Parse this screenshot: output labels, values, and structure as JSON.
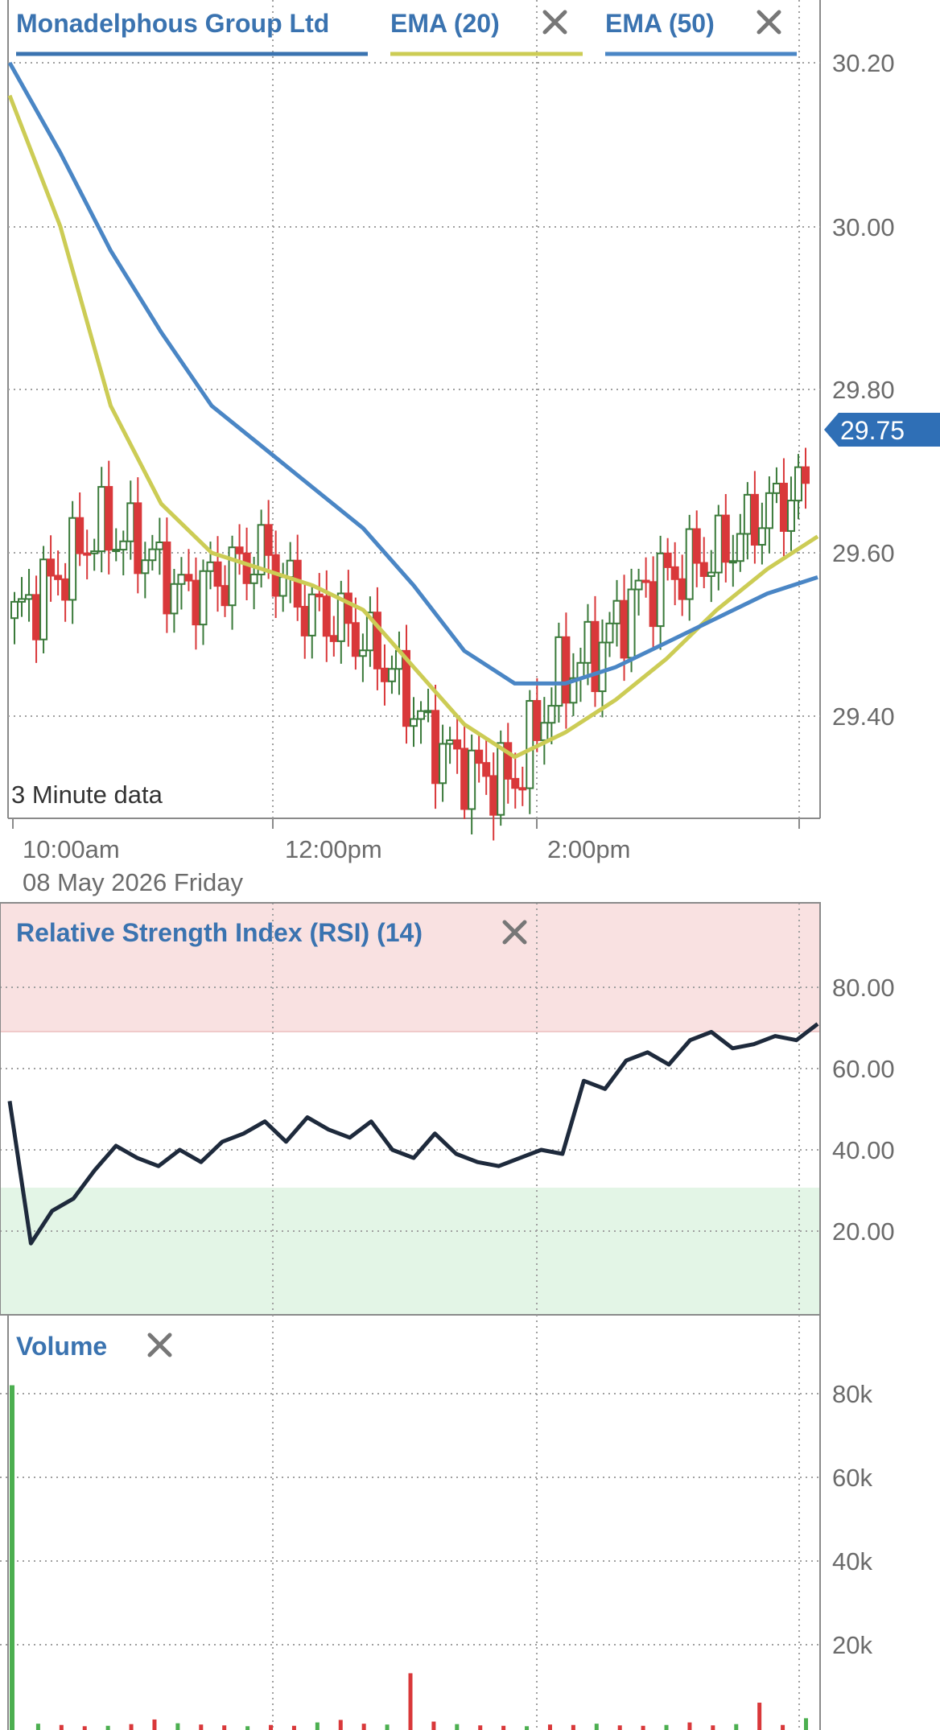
{
  "header": {
    "instrument": "Monadelphous Group Ltd",
    "ema20_label": "EMA (20)",
    "ema50_label": "EMA (50)",
    "close_icon": "close-icon"
  },
  "price_panel": {
    "note": "3 Minute data",
    "current_price": "29.75",
    "y_ticks": [
      "30.20",
      "30.00",
      "29.80",
      "29.60",
      "29.40"
    ],
    "x_ticks": [
      "10:00am",
      "12:00pm",
      "2:00pm"
    ],
    "date_label": "08 May 2026 Friday"
  },
  "rsi_panel": {
    "title": "Relative Strength Index (RSI) (14)",
    "y_ticks": [
      "80.00",
      "60.00",
      "40.00",
      "20.00"
    ]
  },
  "volume_panel": {
    "title": "Volume",
    "y_ticks": [
      "80k",
      "60k",
      "40k",
      "20k"
    ]
  },
  "colors": {
    "instrument": "#3a73b0",
    "ema20": "#cccc55",
    "ema50": "#4a86c5",
    "up": "#3a7a3a",
    "down": "#d9383a",
    "rsi": "#1e2a3c",
    "overbought": "#f9e1e1",
    "oversold": "#e3f5e6",
    "badge": "#2f6fb6"
  },
  "chart_data": [
    {
      "type": "line",
      "title": "Monadelphous Group Ltd",
      "subtitle": "3 Minute data",
      "x_ticks": [
        "10:00am",
        "12:00pm",
        "2:00pm"
      ],
      "ylim": [
        29.28,
        30.22
      ],
      "current_price": 29.75,
      "series": [
        {
          "name": "EMA (20)",
          "values": [
            30.16,
            30.0,
            29.78,
            29.66,
            29.6,
            29.58,
            29.56,
            29.53,
            29.46,
            29.39,
            29.35,
            29.38,
            29.42,
            29.47,
            29.53,
            29.58,
            29.62
          ]
        },
        {
          "name": "EMA (50)",
          "values": [
            30.2,
            30.09,
            29.97,
            29.87,
            29.78,
            29.73,
            29.68,
            29.63,
            29.56,
            29.48,
            29.44,
            29.44,
            29.46,
            29.49,
            29.52,
            29.55,
            29.57
          ]
        },
        {
          "name": "Price close",
          "values": [
            29.52,
            29.57,
            29.63,
            29.61,
            29.55,
            29.57,
            29.6,
            29.53,
            29.51,
            29.46,
            29.37,
            29.33,
            29.32,
            29.44,
            29.48,
            29.55,
            29.58,
            29.6,
            29.65,
            29.68
          ]
        }
      ],
      "grid": true
    },
    {
      "type": "line",
      "title": "Relative Strength Index (RSI) (14)",
      "ylim": [
        0,
        100
      ],
      "bands": {
        "overbought": [
          70,
          100
        ],
        "oversold": [
          0,
          30
        ]
      },
      "series": [
        {
          "name": "Relative Strength Index (RSI) (14)",
          "values": [
            52,
            17,
            25,
            28,
            35,
            41,
            38,
            36,
            40,
            37,
            42,
            44,
            47,
            42,
            48,
            45,
            43,
            47,
            40,
            38,
            44,
            39,
            37,
            36,
            38,
            40,
            39,
            57,
            55,
            62,
            64,
            61,
            67,
            69,
            65,
            66,
            68,
            67,
            71
          ]
        }
      ],
      "grid": true
    },
    {
      "type": "bar",
      "title": "Volume",
      "y_ticks": [
        "80k",
        "60k",
        "40k",
        "20k"
      ],
      "ylim": [
        0,
        90000
      ],
      "values": [
        82000,
        1500,
        1200,
        900,
        1000,
        1400,
        2500,
        1600,
        1300,
        1100,
        900,
        1200,
        1000,
        1800,
        2400,
        1500,
        1300,
        13500,
        2000,
        1400,
        1100,
        1000,
        900,
        1300,
        1200,
        1500,
        1100,
        1000,
        1200,
        1800,
        1100,
        1400,
        6500,
        1200,
        2800
      ]
    }
  ]
}
